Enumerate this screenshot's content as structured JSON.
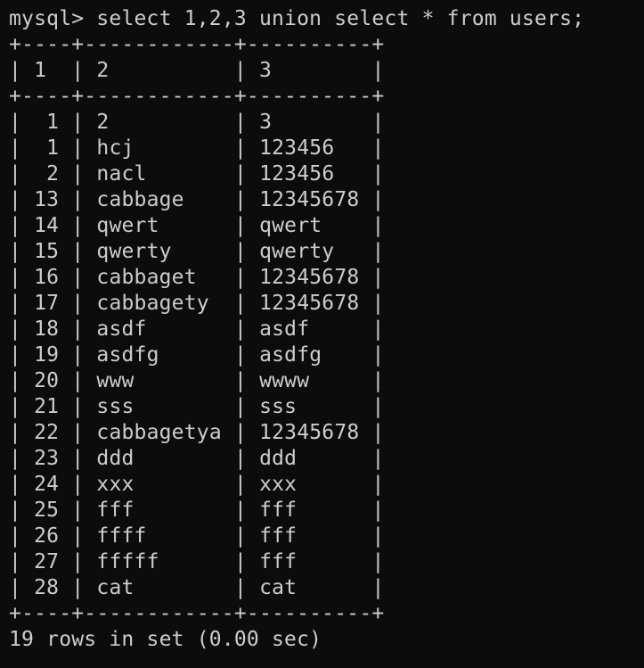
{
  "terminal": {
    "prompt": "mysql>",
    "command": "select 1,2,3 union select * from users;",
    "table": {
      "border": "+----+------------+----------+",
      "headers": [
        "1",
        "2",
        "3"
      ],
      "rows": [
        [
          "1",
          "2",
          "3"
        ],
        [
          "1",
          "hcj",
          "123456"
        ],
        [
          "2",
          "nacl",
          "123456"
        ],
        [
          "13",
          "cabbage",
          "12345678"
        ],
        [
          "14",
          "qwert",
          "qwert"
        ],
        [
          "15",
          "qwerty",
          "qwerty"
        ],
        [
          "16",
          "cabbaget",
          "12345678"
        ],
        [
          "17",
          "cabbagety",
          "12345678"
        ],
        [
          "18",
          "asdf",
          "asdf"
        ],
        [
          "19",
          "asdfg",
          "asdfg"
        ],
        [
          "20",
          "www",
          "wwww"
        ],
        [
          "21",
          "sss",
          "sss"
        ],
        [
          "22",
          "cabbagetya",
          "12345678"
        ],
        [
          "23",
          "ddd",
          "ddd"
        ],
        [
          "24",
          "xxx",
          "xxx"
        ],
        [
          "25",
          "fff",
          "fff"
        ],
        [
          "26",
          "ffff",
          "fff"
        ],
        [
          "27",
          "fffff",
          "fff"
        ],
        [
          "28",
          "cat",
          "cat"
        ]
      ]
    },
    "footer": "19 rows in set (0.00 sec)"
  },
  "colors": {
    "background": "#0c0c0c",
    "text": "#cccccc"
  }
}
